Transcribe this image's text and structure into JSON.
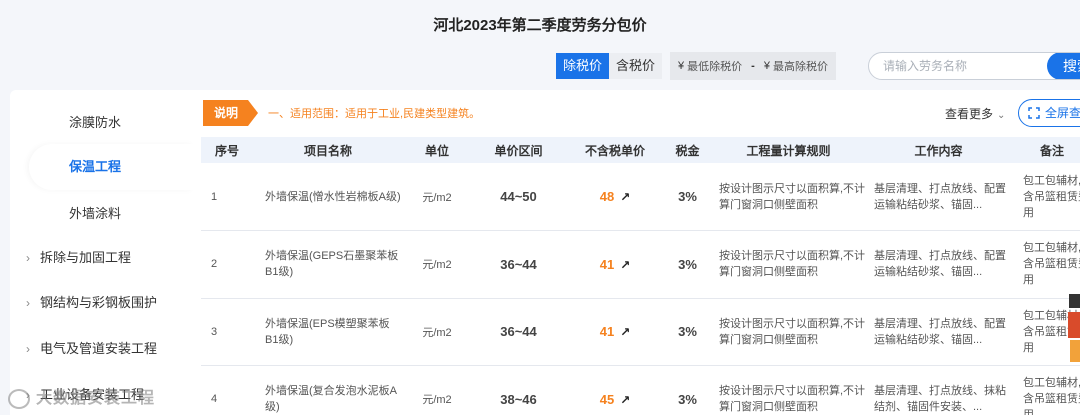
{
  "page_title": "河北2023年第二季度劳务分包价",
  "toolbar": {
    "tax_excluded": "除税价",
    "tax_included": "含税价",
    "currency": "¥",
    "min_placeholder": "最低除税价",
    "dash": "-",
    "max_placeholder": "最高除税价"
  },
  "search": {
    "placeholder": "请输入劳务名称",
    "button": "搜索"
  },
  "sidebar": {
    "sub_items": [
      {
        "label": "涂膜防水"
      },
      {
        "label": "保温工程"
      },
      {
        "label": "外墙涂料"
      }
    ],
    "groups": [
      {
        "label": "拆除与加固工程"
      },
      {
        "label": "钢结构与彩钢板围护"
      },
      {
        "label": "电气及管道安装工程"
      },
      {
        "label": "工业设备安装工程"
      }
    ],
    "chevron": "›"
  },
  "note": {
    "badge": "说明",
    "text": "一、适用范围：适用于工业,民建类型建筑。"
  },
  "more": {
    "label": "查看更多",
    "chevron": "⌄"
  },
  "fullscreen": {
    "label": "全屏查看"
  },
  "table": {
    "headers": [
      "序号",
      "项目名称",
      "单位",
      "单价区间",
      "不含税单价",
      "税金",
      "工程量计算规则",
      "工作内容",
      "备注"
    ],
    "rows": [
      {
        "no": "1",
        "name": "外墙保温(憎水性岩棉板A级)",
        "unit": "元/m2",
        "range": "44~50",
        "price": "48",
        "tax": "3%",
        "rule": "按设计图示尺寸以面积算,不计算门窗洞口侧壁面积",
        "work": "基层清理、打点放线、配置运输粘结砂浆、锚固...",
        "remark": "包工包辅材,不含吊篮租赁费用"
      },
      {
        "no": "2",
        "name": "外墙保温(GEPS石墨聚苯板B1级)",
        "unit": "元/m2",
        "range": "36~44",
        "price": "41",
        "tax": "3%",
        "rule": "按设计图示尺寸以面积算,不计算门窗洞口侧壁面积",
        "work": "基层清理、打点放线、配置运输粘结砂浆、锚固...",
        "remark": "包工包辅材,不含吊篮租赁费用"
      },
      {
        "no": "3",
        "name": "外墙保温(EPS模塑聚苯板B1级)",
        "unit": "元/m2",
        "range": "36~44",
        "price": "41",
        "tax": "3%",
        "rule": "按设计图示尺寸以面积算,不计算门窗洞口侧壁面积",
        "work": "基层清理、打点放线、配置运输粘结砂浆、锚固...",
        "remark": "包工包辅材,不含吊篮租赁费用"
      },
      {
        "no": "4",
        "name": "外墙保温(复合发泡水泥板A级)",
        "unit": "元/m2",
        "range": "38~46",
        "price": "45",
        "tax": "3%",
        "rule": "按设计图示尺寸以面积算,不计算门窗洞口侧壁面积",
        "work": "基层清理、打点放线、抹粘结剂、锚固件安装、...",
        "remark": "包工包辅材,不含吊篮租赁费用"
      }
    ],
    "trend_icon": "trend-up-icon",
    "trend_glyph": "↗"
  },
  "watermark": {
    "text": "大数据安装工程"
  },
  "colors": {
    "primary": "#1a73e8",
    "accent": "#f5821f"
  }
}
